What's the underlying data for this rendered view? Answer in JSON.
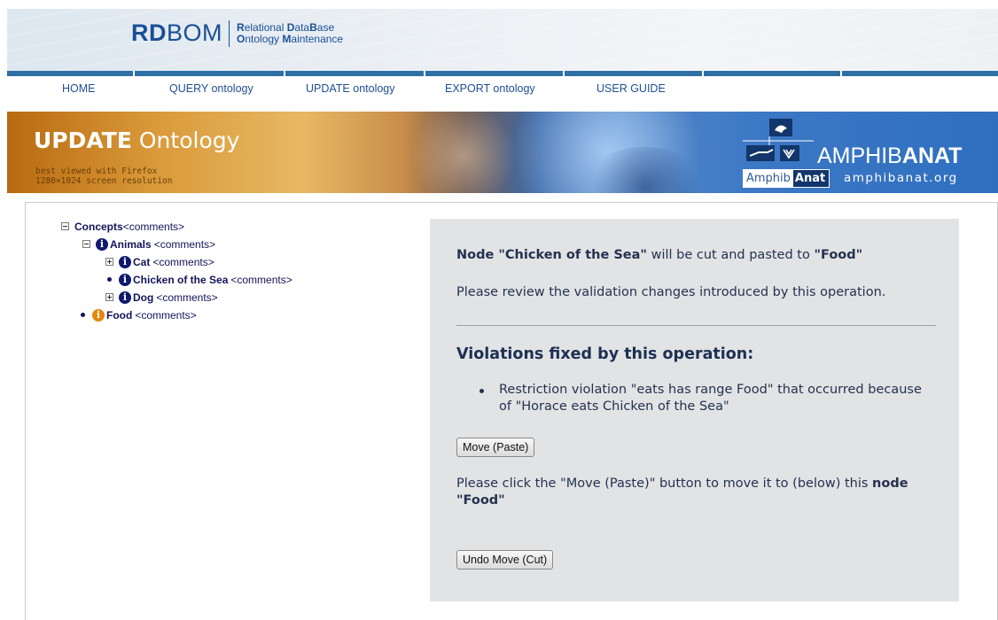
{
  "header": {
    "logo_main_bold": "RD",
    "logo_main_rest": "BOM",
    "logo_sub_line1_b1": "R",
    "logo_sub_line1_r1": "elational ",
    "logo_sub_line1_b2": "D",
    "logo_sub_line1_r2": "ata",
    "logo_sub_line1_b3": "B",
    "logo_sub_line1_r3": "ase",
    "logo_sub_line2_b1": "O",
    "logo_sub_line2_r1": "ntology ",
    "logo_sub_line2_b2": "M",
    "logo_sub_line2_r2": "aintenance"
  },
  "nav": {
    "items": [
      "HOME",
      "QUERY ontology",
      "UPDATE ontology",
      "EXPORT ontology",
      "USER GUIDE"
    ]
  },
  "banner": {
    "title_bold": "UPDATE",
    "title_rest": "Ontology",
    "note_line1": "best viewed with Firefox",
    "note_line2": "1280×1024 screen resolution",
    "brand_regular": "AMPHIB",
    "brand_bold": "ANAT",
    "badge_left": "Amphib",
    "badge_right": "Anat",
    "url": "amphibanat.org"
  },
  "tree": {
    "concepts": {
      "name": "Concepts",
      "comments": "<comments>"
    },
    "animals": {
      "name": "Animals",
      "comments": "<comments>"
    },
    "cat": {
      "name": "Cat",
      "comments": "<comments>"
    },
    "chicken": {
      "name": "Chicken of the Sea",
      "comments": "<comments>"
    },
    "dog": {
      "name": "Dog",
      "comments": "<comments>"
    },
    "food": {
      "name": "Food",
      "comments": "<comments>"
    }
  },
  "panel": {
    "line1_prefix": "Node ",
    "line1_node": "\"Chicken of the Sea\"",
    "line1_middle": " will be cut and pasted to ",
    "line1_target": "\"Food\"",
    "review": "Please review the validation changes introduced by this operation.",
    "heading": "Violations fixed by this operation:",
    "violations": [
      "Restriction violation \"eats has range Food\" that occurred because of \"Horace eats Chicken of the Sea\""
    ],
    "move_button": "Move (Paste)",
    "instruction_prefix": "Please click the \"Move (Paste)\" button to move it to (below) this ",
    "instruction_bold": "node \"Food\"",
    "undo_button": "Undo Move (Cut)"
  },
  "colors": {
    "accent_blue": "#1f4f8f",
    "banner_orange": "#d99a3a",
    "info_icon": "#0e1a6e",
    "food_icon": "#e5870d",
    "panel_bg": "#e2e3e5"
  },
  "icons": {
    "tree_toggle_minus": "minus-square-icon",
    "tree_toggle_plus": "plus-square-icon",
    "info": "info-circle-icon"
  }
}
